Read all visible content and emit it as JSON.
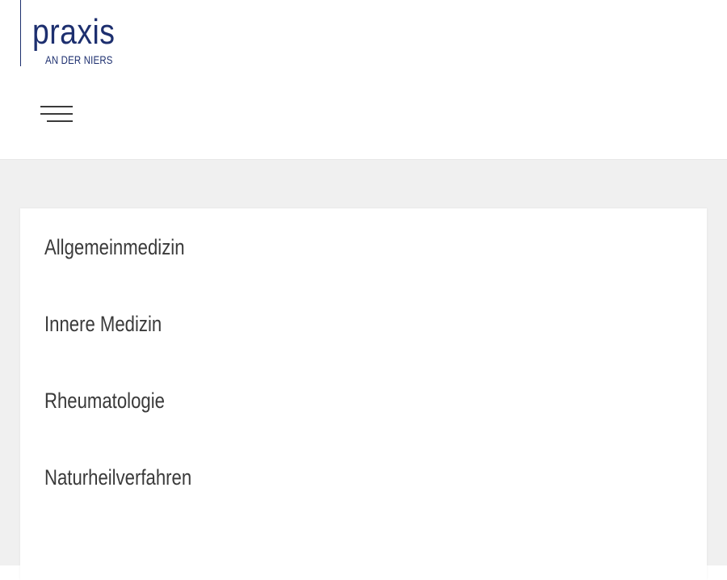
{
  "logo": {
    "main_text": "praxis",
    "sub_text": "AN DER NIERS"
  },
  "header": {
    "menu_icon": "hamburger-menu-icon"
  },
  "colors": {
    "brand": "#1d2f6f",
    "text": "#3a3a3a",
    "page_background": "#f0f0f0"
  },
  "services": [
    {
      "label": "Allgemeinmedizin"
    },
    {
      "label": "Innere Medizin"
    },
    {
      "label": "Rheumatologie"
    },
    {
      "label": "Naturheilverfahren"
    }
  ]
}
